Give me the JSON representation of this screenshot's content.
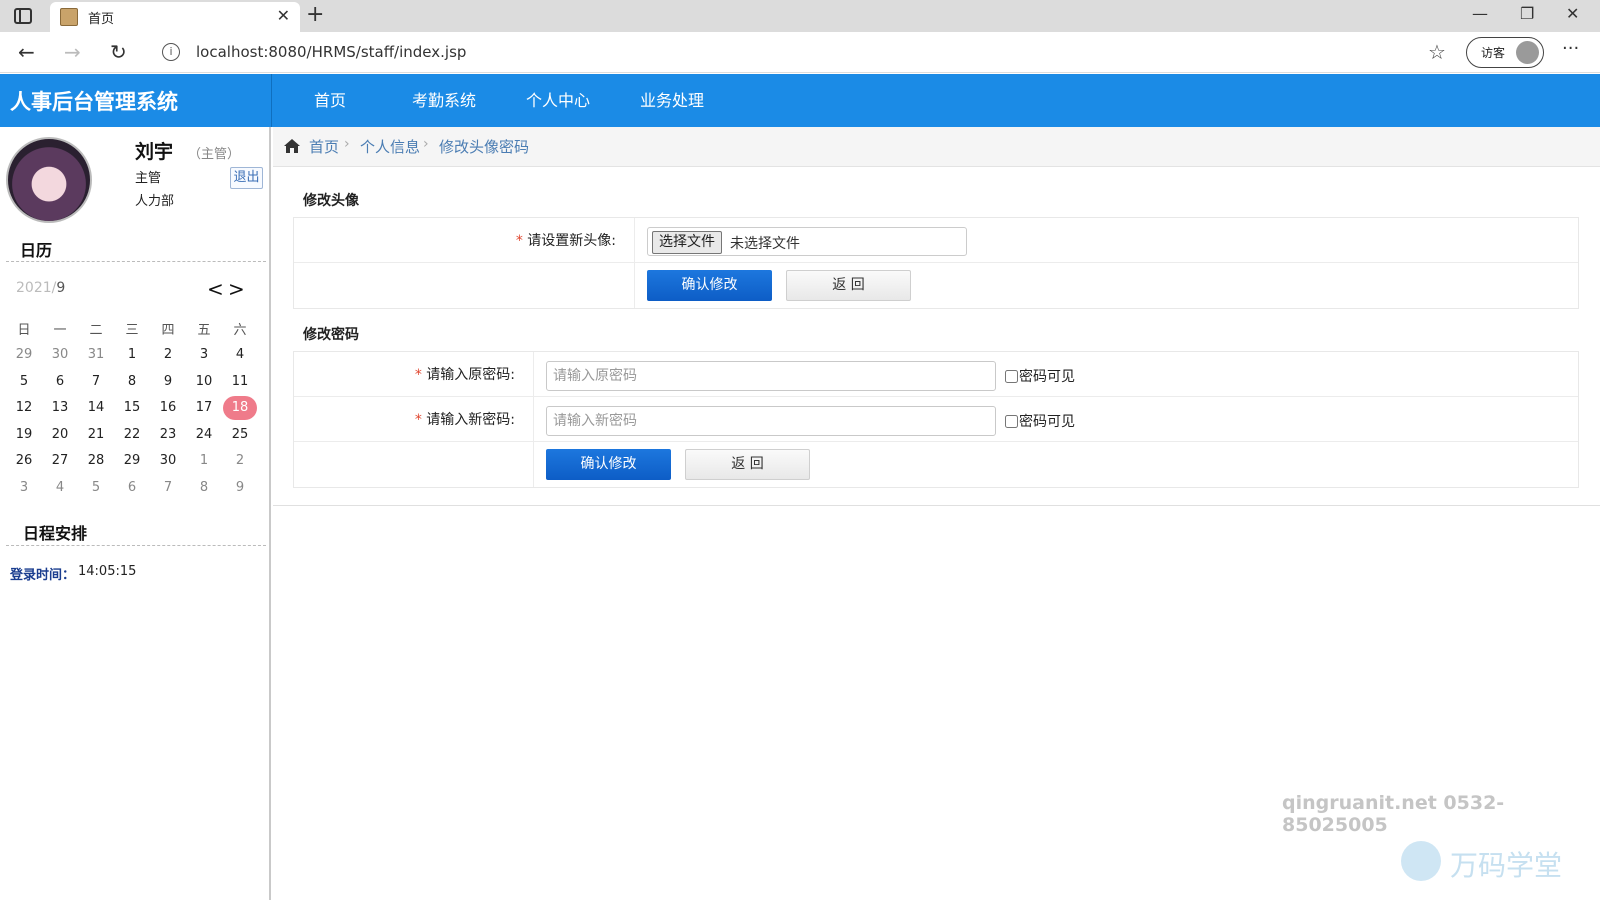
{
  "browser": {
    "tab_title": "首页",
    "url": "localhost:8080/HRMS/staff/index.jsp",
    "guest_label": "访客"
  },
  "app": {
    "title": "人事后台管理系统",
    "nav": [
      "首页",
      "考勤系统",
      "个人中心",
      "业务处理"
    ]
  },
  "user": {
    "name": "刘宇",
    "role_tag": "（主管）",
    "title": "主管",
    "department": "人力部",
    "logout_label": "退出"
  },
  "calendar": {
    "section_title": "日历",
    "year_label": "2021/",
    "month_label": "9",
    "prev_label": "<",
    "next_label": ">",
    "weekdays": [
      "日",
      "一",
      "二",
      "三",
      "四",
      "五",
      "六"
    ],
    "today": "18",
    "weeks": [
      [
        {
          "d": "29",
          "m": true
        },
        {
          "d": "30",
          "m": true
        },
        {
          "d": "31",
          "m": true
        },
        {
          "d": "1"
        },
        {
          "d": "2"
        },
        {
          "d": "3"
        },
        {
          "d": "4"
        }
      ],
      [
        {
          "d": "5"
        },
        {
          "d": "6"
        },
        {
          "d": "7"
        },
        {
          "d": "8"
        },
        {
          "d": "9"
        },
        {
          "d": "10"
        },
        {
          "d": "11"
        }
      ],
      [
        {
          "d": "12"
        },
        {
          "d": "13"
        },
        {
          "d": "14"
        },
        {
          "d": "15"
        },
        {
          "d": "16"
        },
        {
          "d": "17"
        },
        {
          "d": "18",
          "t": true
        }
      ],
      [
        {
          "d": "19"
        },
        {
          "d": "20"
        },
        {
          "d": "21"
        },
        {
          "d": "22"
        },
        {
          "d": "23"
        },
        {
          "d": "24"
        },
        {
          "d": "25"
        }
      ],
      [
        {
          "d": "26"
        },
        {
          "d": "27"
        },
        {
          "d": "28"
        },
        {
          "d": "29"
        },
        {
          "d": "30"
        },
        {
          "d": "1",
          "m": true
        },
        {
          "d": "2",
          "m": true
        }
      ],
      [
        {
          "d": "3",
          "m": true
        },
        {
          "d": "4",
          "m": true
        },
        {
          "d": "5",
          "m": true
        },
        {
          "d": "6",
          "m": true
        },
        {
          "d": "7",
          "m": true
        },
        {
          "d": "8",
          "m": true
        },
        {
          "d": "9",
          "m": true
        }
      ]
    ]
  },
  "schedule": {
    "section_title": "日程安排",
    "login_label": "登录时间：",
    "login_time": "14:05:15"
  },
  "breadcrumb": [
    "首页",
    "个人信息",
    "修改头像密码"
  ],
  "avatar_form": {
    "title": "修改头像",
    "required_mark": "*",
    "label": "请设置新头像:",
    "file_button": "选择文件",
    "file_status": "未选择文件",
    "confirm": "确认修改",
    "back": "返 回"
  },
  "password_form": {
    "title": "修改密码",
    "required_mark": "*",
    "old_label": "请输入原密码:",
    "old_placeholder": "请输入原密码",
    "new_label": "请输入新密码:",
    "new_placeholder": "请输入新密码",
    "show_label": "密码可见",
    "confirm": "确认修改",
    "back": "返 回"
  },
  "watermark": {
    "contact": "qingruanit.net 0532-85025005",
    "brand": "万码学堂"
  },
  "colors": {
    "header_blue": "#1b8be6",
    "primary_button": "#0d5dc6",
    "today_highlight": "#ef7b8a",
    "link": "#4b7db3"
  }
}
